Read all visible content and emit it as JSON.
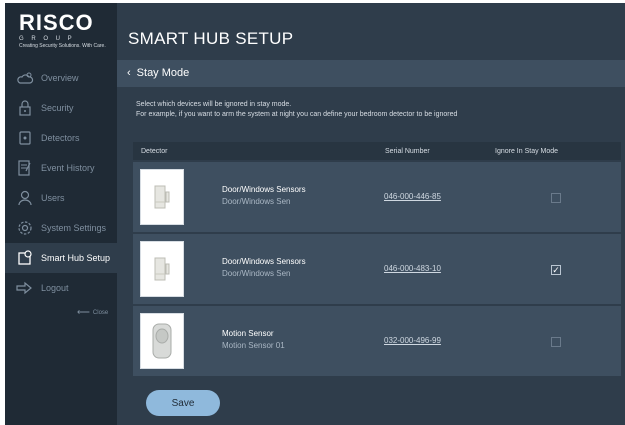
{
  "app": {
    "brand": "RISCO",
    "brand_sub": "G R O U P",
    "brand_tag": "Creating Security Solutions. With Care."
  },
  "sidebar": {
    "items": [
      {
        "label": "Overview",
        "icon": "cloud-sun-icon",
        "active": false
      },
      {
        "label": "Security",
        "icon": "lock-icon",
        "active": false
      },
      {
        "label": "Detectors",
        "icon": "detector-icon",
        "active": false
      },
      {
        "label": "Event History",
        "icon": "event-history-icon",
        "active": false
      },
      {
        "label": "Users",
        "icon": "user-icon",
        "active": false
      },
      {
        "label": "System Settings",
        "icon": "gear-icon",
        "active": false
      },
      {
        "label": "Smart Hub Setup",
        "icon": "smart-hub-icon",
        "active": true
      },
      {
        "label": "Logout",
        "icon": "logout-icon",
        "active": false
      }
    ],
    "close_label": "Close"
  },
  "header": {
    "title": "SMART HUB SETUP"
  },
  "subheader": {
    "back_label": "Stay Mode"
  },
  "description": {
    "line1": "Select which devices will be ignored in stay mode.",
    "line2": "For example, if you want to arm the system at night you can define your bedroom detector to be ignored"
  },
  "table": {
    "columns": {
      "detector": "Detector",
      "serial": "Serial Number",
      "ignore": "Ignore In Stay Mode"
    },
    "rows": [
      {
        "name": "Door/Windows Sensors",
        "sub": "Door/Windows Sen",
        "serial": "046-000-446-85",
        "checked": false,
        "device": "door-window-sensor"
      },
      {
        "name": "Door/Windows Sensors",
        "sub": "Door/Windows Sen",
        "serial": "046-000-483-10",
        "checked": true,
        "device": "door-window-sensor"
      },
      {
        "name": "Motion Sensor",
        "sub": "Motion Sensor 01",
        "serial": "032-000-496-99",
        "checked": false,
        "device": "motion-sensor"
      }
    ]
  },
  "actions": {
    "save_label": "Save"
  },
  "colors": {
    "sidebar_bg": "#1f2a35",
    "main_bg": "#2f3d4b",
    "row_bg": "#3e4f60",
    "accent": "#8fb9dc"
  }
}
